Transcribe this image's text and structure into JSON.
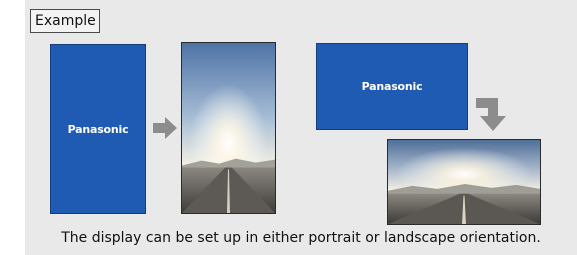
{
  "example_label": "Example",
  "portrait_screen": {
    "brand": "Panasonic"
  },
  "landscape_screen": {
    "brand": "Panasonic"
  },
  "caption": "The display can be set up in either portrait or landscape orientation.",
  "colors": {
    "panel_background": "#e9e9e9",
    "screen_blue": "#1f5bb3",
    "arrow_gray": "#8c8c8c"
  },
  "icons": {
    "right_arrow": "right-arrow-icon",
    "down_arrow": "bent-down-arrow-icon"
  }
}
